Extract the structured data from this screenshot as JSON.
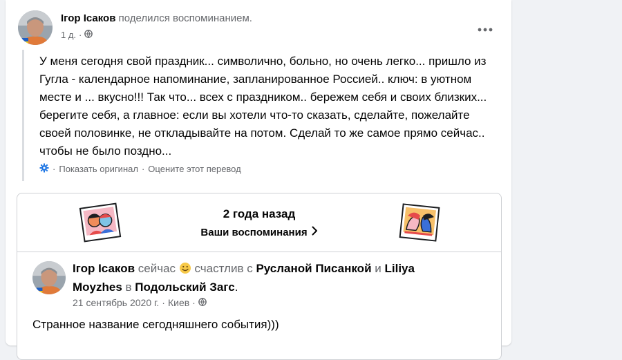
{
  "post": {
    "author": "Ігор Ісаков",
    "action": "поделился воспоминанием.",
    "time": "1 д.",
    "separator": "·",
    "text": "У меня сегодня свой праздник... символично, больно, но очень легко... пришло из Гугла - календарное напоминание, запланированное Россией.. ключ: в уютном месте и ... вкусно!!! Так что... всех с праздником.. бережем себя и своих близких... берегите себя, а главное: если вы хотели что-то сказать, сделайте, пожелайте своей половинке, не откладывайте на потом. Сделай то же самое прямо сейчас.. чтобы не было поздно...",
    "show_original": "Показать оригинал",
    "rate_translation": "Оцените этот перевод"
  },
  "memory": {
    "years_ago": "2 года назад",
    "your_memories": "Ваши воспоминания",
    "inner": {
      "author": "Ігор Ісаков",
      "status": "сейчас",
      "feeling": "счастлив с",
      "tag1": "Русланой Писанкой",
      "and": "и",
      "tag2": "Liliya Moyzhes",
      "in": "в",
      "place": "Подольский Загс",
      "period": ".",
      "date": "21 сентябрь 2020 г.",
      "location": "Киев",
      "text": "Странное название сегодняшнего события)))"
    }
  },
  "icons": {
    "privacy": "globe-icon",
    "more": "more-dots-icon",
    "translate": "gear-icon",
    "chevron": "chevron-right-icon",
    "emoji": "smile-emoji-icon"
  }
}
